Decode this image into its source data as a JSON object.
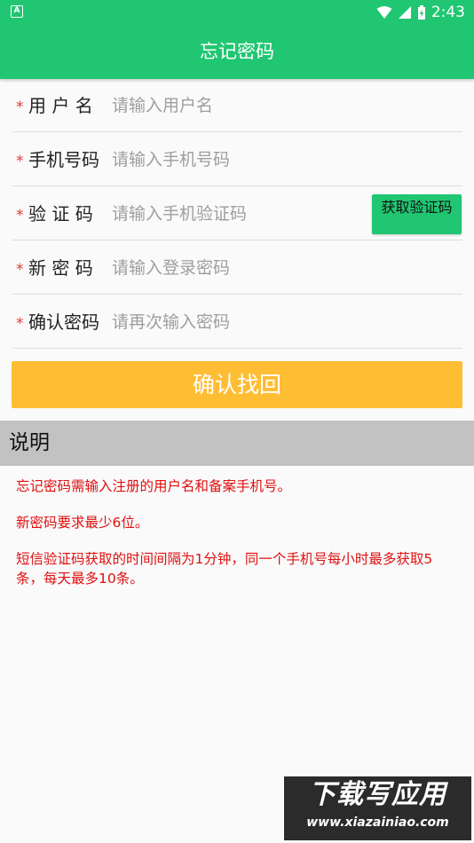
{
  "status_bar": {
    "time": "2:43",
    "notification_letter": "A"
  },
  "app_bar": {
    "title": "忘记密码"
  },
  "form": {
    "rows": [
      {
        "required": "*",
        "label": "用 户 名",
        "placeholder": "请输入用户名",
        "value": ""
      },
      {
        "required": "*",
        "label": "手机号码",
        "placeholder": "请输入手机号码",
        "value": ""
      },
      {
        "required": "*",
        "label": "验 证 码",
        "placeholder": "请输入手机验证码",
        "value": ""
      },
      {
        "required": "*",
        "label": "新 密 码",
        "placeholder": "请输入登录密码",
        "value": ""
      },
      {
        "required": "*",
        "label": "确认密码",
        "placeholder": "请再次输入密码",
        "value": ""
      }
    ],
    "get_code_button": "获取验证码",
    "submit_button": "确认找回"
  },
  "notes": {
    "title": "说明",
    "lines": [
      "忘记密码需输入注册的用户名和备案手机号。",
      "新密码要求最少6位。",
      "短信验证码获取的时间间隔为1分钟，同一个手机号每小时最多获取5条，每天最多10条。"
    ]
  },
  "watermark": {
    "title": "下载写应用",
    "url": "www.xiazainiao.com"
  },
  "colors": {
    "primary": "#20c672",
    "accent": "#ffbd33",
    "required": "#e53935",
    "notes_text": "#e01010",
    "notes_header_bg": "#c2c2c2"
  }
}
